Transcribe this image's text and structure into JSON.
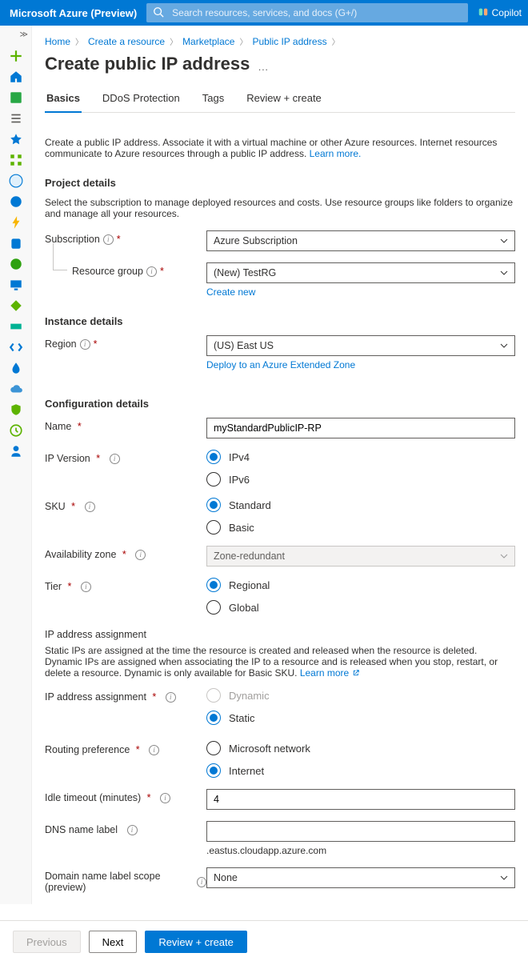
{
  "header": {
    "brand": "Microsoft Azure (Preview)",
    "search_placeholder": "Search resources, services, and docs (G+/)",
    "copilot_label": "Copilot"
  },
  "breadcrumbs": {
    "items": [
      {
        "label": "Home"
      },
      {
        "label": "Create a resource"
      },
      {
        "label": "Marketplace"
      },
      {
        "label": "Public IP address"
      }
    ]
  },
  "page_title": "Create public IP address",
  "tabs": [
    {
      "label": "Basics",
      "active": true
    },
    {
      "label": "DDoS Protection"
    },
    {
      "label": "Tags"
    },
    {
      "label": "Review + create"
    }
  ],
  "intro": {
    "text": "Create a public IP address. Associate it with a virtual machine or other Azure resources. Internet resources communicate to Azure resources through a public IP address. ",
    "learn_more": "Learn more."
  },
  "project_details": {
    "heading": "Project details",
    "help": "Select the subscription to manage deployed resources and costs. Use resource groups like folders to organize and manage all your resources.",
    "subscription_label": "Subscription",
    "subscription_value": "Azure Subscription",
    "rg_label": "Resource group",
    "rg_value": "(New) TestRG",
    "create_new": "Create new"
  },
  "instance_details": {
    "heading": "Instance details",
    "region_label": "Region",
    "region_value": "(US) East US",
    "extended_zone": "Deploy to an Azure Extended Zone"
  },
  "config": {
    "heading": "Configuration details",
    "name_label": "Name",
    "name_value": "myStandardPublicIP-RP",
    "ipv_label": "IP Version",
    "ipv4": "IPv4",
    "ipv6": "IPv6",
    "sku_label": "SKU",
    "sku_standard": "Standard",
    "sku_basic": "Basic",
    "az_label": "Availability zone",
    "az_value": "Zone-redundant",
    "tier_label": "Tier",
    "tier_regional": "Regional",
    "tier_global": "Global",
    "assignment_head": "IP address assignment",
    "assignment_desc": "Static IPs are assigned at the time the resource is created and released when the resource is deleted. Dynamic IPs are assigned when associating the IP to a resource and is released when you stop, restart, or delete a resource. Dynamic is only available for Basic SKU. ",
    "assignment_learn": "Learn more",
    "assignment_label": "IP address assignment",
    "assignment_dynamic": "Dynamic",
    "assignment_static": "Static",
    "routing_label": "Routing preference",
    "routing_ms": "Microsoft network",
    "routing_internet": "Internet",
    "idle_label": "Idle timeout (minutes)",
    "idle_value": "4",
    "dns_label": "DNS name label",
    "dns_value": "",
    "dns_suffix": ".eastus.cloudapp.azure.com",
    "scope_label": "Domain name label scope (preview)",
    "scope_value": "None"
  },
  "footer": {
    "previous": "Previous",
    "next": "Next",
    "review": "Review + create"
  }
}
